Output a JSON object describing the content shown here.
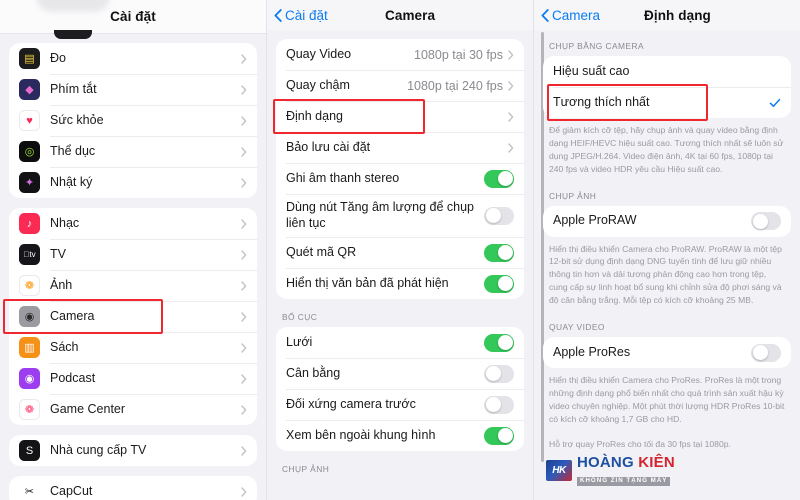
{
  "left_panel": {
    "title": "Cài đặt",
    "groups": [
      {
        "items": [
          {
            "label": "Đo",
            "icon": "measure-app-icon",
            "glyph": "▤",
            "bg": "#1c1c1e",
            "fg": "#f5d13a"
          },
          {
            "label": "Phím tắt",
            "icon": "shortcuts-app-icon",
            "glyph": "◆",
            "bg": "#2a2a5e",
            "fg": "#e86bd0"
          },
          {
            "label": "Sức khỏe",
            "icon": "health-app-icon",
            "glyph": "♥",
            "bg": "#ffffff",
            "fg": "#fb2a55"
          },
          {
            "label": "Thể dục",
            "icon": "fitness-app-icon",
            "glyph": "◎",
            "bg": "#0d0d0f",
            "fg": "#9fe630"
          },
          {
            "label": "Nhật ký",
            "icon": "journal-app-icon",
            "glyph": "✦",
            "bg": "#121214",
            "fg": "#d86fe0"
          }
        ]
      },
      {
        "items": [
          {
            "label": "Nhạc",
            "icon": "music-app-icon",
            "glyph": "♪",
            "bg": "#fa2a52",
            "fg": "#ffffff"
          },
          {
            "label": "TV",
            "icon": "tv-app-icon",
            "glyph": "tv",
            "bg": "#16161a",
            "fg": "#ffffff"
          },
          {
            "label": "Ảnh",
            "icon": "photos-app-icon",
            "glyph": "❁",
            "bg": "#ffffff",
            "fg": "#ff9500"
          },
          {
            "label": "Camera",
            "icon": "camera-app-icon",
            "glyph": "◉",
            "bg": "#9b9ba1",
            "fg": "#2b2b2e"
          },
          {
            "label": "Sách",
            "icon": "books-app-icon",
            "glyph": "▥",
            "bg": "#f59019",
            "fg": "#ffffff"
          },
          {
            "label": "Podcast",
            "icon": "podcasts-app-icon",
            "glyph": "◉",
            "bg": "#9d3df0",
            "fg": "#ffffff"
          },
          {
            "label": "Game Center",
            "icon": "game-center-app-icon",
            "glyph": "❁",
            "bg": "#ffffff",
            "fg": "#ff3b6b"
          }
        ]
      },
      {
        "items": [
          {
            "label": "Nhà cung cấp TV",
            "icon": "tv-provider-app-icon",
            "glyph": "S",
            "bg": "#141416",
            "fg": "#ffffff"
          }
        ]
      },
      {
        "items": [
          {
            "label": "CapCut",
            "icon": "capcut-app-icon",
            "glyph": "✂",
            "bg": "#ffffff",
            "fg": "#111114"
          }
        ]
      }
    ],
    "highlight_item": "Camera"
  },
  "mid_panel": {
    "back_label": "Cài đặt",
    "title": "Camera",
    "groups": [
      {
        "header": "",
        "items": [
          {
            "label": "Quay Video",
            "value": "1080p tại 30 fps",
            "type": "disclosure"
          },
          {
            "label": "Quay chậm",
            "value": "1080p tại 240 fps",
            "type": "disclosure"
          },
          {
            "label": "Định dạng",
            "value": "",
            "type": "disclosure",
            "highlighted": true
          },
          {
            "label": "Bảo lưu cài đặt",
            "value": "",
            "type": "disclosure"
          },
          {
            "label": "Ghi âm thanh stereo",
            "type": "toggle",
            "on": true
          },
          {
            "label": "Dùng nút Tăng âm lượng để chụp liên tục",
            "type": "toggle",
            "on": false
          },
          {
            "label": "Quét mã QR",
            "type": "toggle",
            "on": true
          },
          {
            "label": "Hiển thị văn bản đã phát hiện",
            "type": "toggle",
            "on": true
          }
        ]
      },
      {
        "header": "BỐ CỤC",
        "items": [
          {
            "label": "Lưới",
            "type": "toggle",
            "on": true
          },
          {
            "label": "Cân bằng",
            "type": "toggle",
            "on": false
          },
          {
            "label": "Đối xứng camera trước",
            "type": "toggle",
            "on": false
          },
          {
            "label": "Xem bên ngoài khung hình",
            "type": "toggle",
            "on": true
          }
        ]
      },
      {
        "header": "CHỤP ẢNH",
        "items": []
      }
    ]
  },
  "right_panel": {
    "back_label": "Camera",
    "title": "Định dạng",
    "sections": [
      {
        "header": "CHỤP BẰNG CAMERA",
        "items": [
          {
            "label": "Hiệu suất cao",
            "checked": false
          },
          {
            "label": "Tương thích nhất",
            "checked": true,
            "highlighted": true
          }
        ],
        "footnote": "Để giảm kích cỡ tệp, hãy chụp ảnh và quay video bằng định dạng HEIF/HEVC hiệu suất cao. Tương thích nhất sẽ luôn sử dụng JPEG/H.264. Video điện ảnh, 4K tại 60 fps, 1080p tại 240 fps và video HDR yêu cầu Hiệu suất cao."
      },
      {
        "header": "CHỤP ẢNH",
        "toggle_item": {
          "label": "Apple ProRAW",
          "on": false
        },
        "footnote": "Hiển thị điều khiển Camera cho ProRAW. ProRAW là một tệp 12-bit sử dụng định dạng DNG tuyến tính để lưu giữ nhiều thông tin hơn và dải tương phản động cao hơn trong tệp, cung cấp sự linh hoạt bổ sung khi chỉnh sửa độ phơi sáng và độ cân bằng trắng. Mỗi tệp có kích cỡ khoảng 25 MB."
      },
      {
        "header": "QUAY VIDEO",
        "toggle_item": {
          "label": "Apple ProRes",
          "on": false
        },
        "footnote": "Hiển thị điều khiển Camera cho ProRes. ProRes là một trong những định dạng phổ biến nhất cho quá trình sản xuất hậu kỳ video chuyên nghiệp. Một phút thời lượng HDR ProRes 10-bit có kích cỡ khoảng 1,7 GB cho HD.",
        "footnote2": "Hỗ trợ quay ProRes cho tối đa 30 fps tại 1080p."
      }
    ]
  },
  "watermark": {
    "badge": "HK",
    "name_part1": "HOÀNG",
    "name_part2": "KIÊN",
    "tagline": "KHÔNG ZIN TẶNG MÁY"
  },
  "colors": {
    "accent_blue": "#0b7cf0",
    "toggle_green": "#34c759",
    "highlight_red": "#f0282d",
    "page_bg": "#f1f1f6"
  }
}
